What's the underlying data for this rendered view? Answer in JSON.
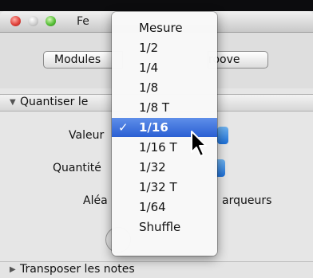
{
  "window": {
    "title_visible": "Fe"
  },
  "segmented": {
    "left_label": "Modules",
    "right_label": "roove"
  },
  "section_quantize": {
    "label": "Quantiser le"
  },
  "fields": {
    "valeur_label": "Valeur",
    "quantite_label": "Quantité",
    "aleatoire_label": "Aléa",
    "marqueurs_label": "arqueurs"
  },
  "section_transpose": {
    "label": "Transposer les notes"
  },
  "menu": {
    "items": [
      {
        "label": "Mesure",
        "selected": false
      },
      {
        "label": "1/2",
        "selected": false
      },
      {
        "label": "1/4",
        "selected": false
      },
      {
        "label": "1/8",
        "selected": false
      },
      {
        "label": "1/8 T",
        "selected": false
      },
      {
        "label": "1/16",
        "selected": true
      },
      {
        "label": "1/16 T",
        "selected": false
      },
      {
        "label": "1/32",
        "selected": false
      },
      {
        "label": "1/32 T",
        "selected": false
      },
      {
        "label": "1/64",
        "selected": false
      },
      {
        "label": "Shuffle",
        "selected": false
      }
    ],
    "checkmark": "✓"
  },
  "colors": {
    "selection": "#2a5fd3",
    "stepper_accent": "#1d6fd6"
  }
}
